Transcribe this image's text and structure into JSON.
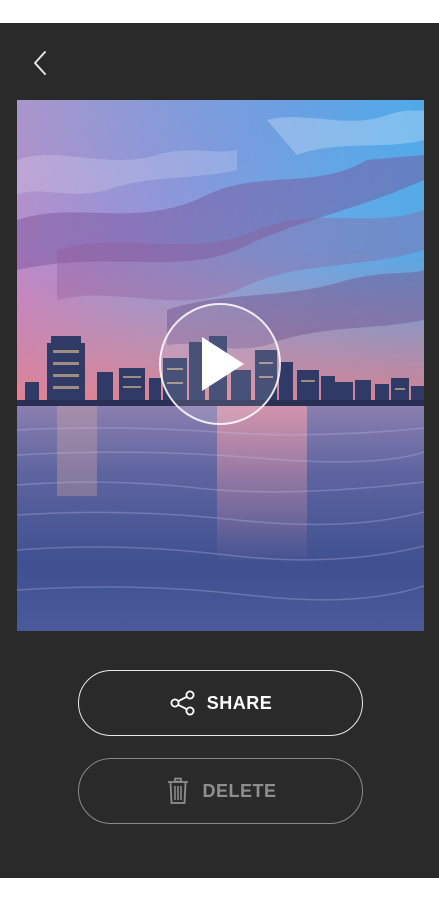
{
  "header": {
    "back_icon": "chevron-left-icon"
  },
  "media": {
    "type": "video",
    "play_icon": "play-icon"
  },
  "actions": {
    "share_label": "SHARE",
    "share_icon": "share-icon",
    "delete_label": "DELETE",
    "delete_icon": "trash-icon"
  },
  "colors": {
    "background": "#2a2a2a",
    "share_text": "#ffffff",
    "delete_text": "#8f8f8f"
  }
}
